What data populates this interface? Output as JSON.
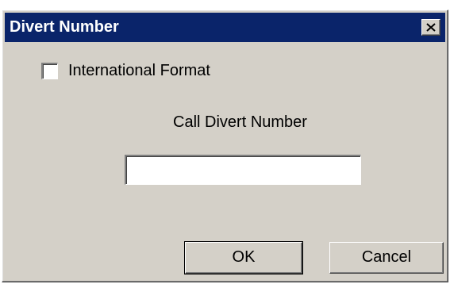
{
  "dialog": {
    "title": "Divert Number",
    "close_icon": "close-icon",
    "international_format": {
      "label": "International Format",
      "checked": false
    },
    "field_label": "Call Divert Number",
    "number_input": {
      "value": "",
      "placeholder": ""
    },
    "ok_label": "OK",
    "cancel_label": "Cancel"
  },
  "colors": {
    "title_bar": "#0a246a",
    "face": "#d4d0c8"
  }
}
